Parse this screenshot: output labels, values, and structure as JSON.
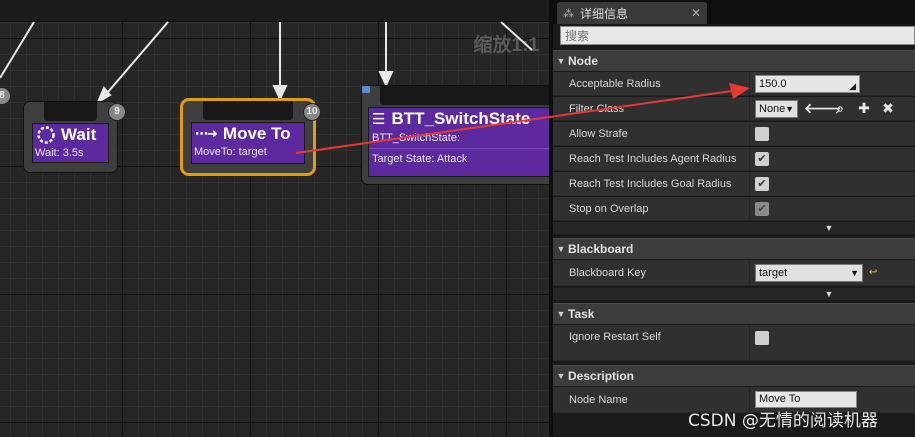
{
  "graph": {
    "zoom_label": "缩放1:1",
    "nodes": {
      "wait": {
        "title": "Wait",
        "subtitle": "Wait: 3.5s",
        "badge": "9",
        "left_badge": "8"
      },
      "moveto": {
        "title": "Move To",
        "subtitle": "MoveTo: target",
        "badge": "10"
      },
      "btt": {
        "title": "BTT_SwitchState",
        "subtitle": "BTT_SwitchState:",
        "detail": "Target State: Attack"
      }
    }
  },
  "details": {
    "tab_title": "详细信息",
    "search_placeholder": "搜索",
    "sections": {
      "node": {
        "title": "Node",
        "acceptable_radius_label": "Acceptable Radius",
        "acceptable_radius_value": "150.0",
        "filter_class_label": "Filter Class",
        "filter_class_value": "None",
        "allow_strafe_label": "Allow Strafe",
        "reach_agent_label": "Reach Test Includes Agent Radius",
        "reach_goal_label": "Reach Test Includes Goal Radius",
        "stop_overlap_label": "Stop on Overlap"
      },
      "blackboard": {
        "title": "Blackboard",
        "key_label": "Blackboard Key",
        "key_value": "target"
      },
      "task": {
        "title": "Task",
        "ignore_restart_label": "Ignore Restart Self"
      },
      "description": {
        "title": "Description",
        "node_name_label": "Node Name",
        "node_name_value": "Move To"
      }
    }
  },
  "watermark": "CSDN @无情的阅读机器",
  "colors": {
    "task_node": "#5c2a9e",
    "selection": "#e49a13",
    "annotation_arrow": "#e53935"
  }
}
